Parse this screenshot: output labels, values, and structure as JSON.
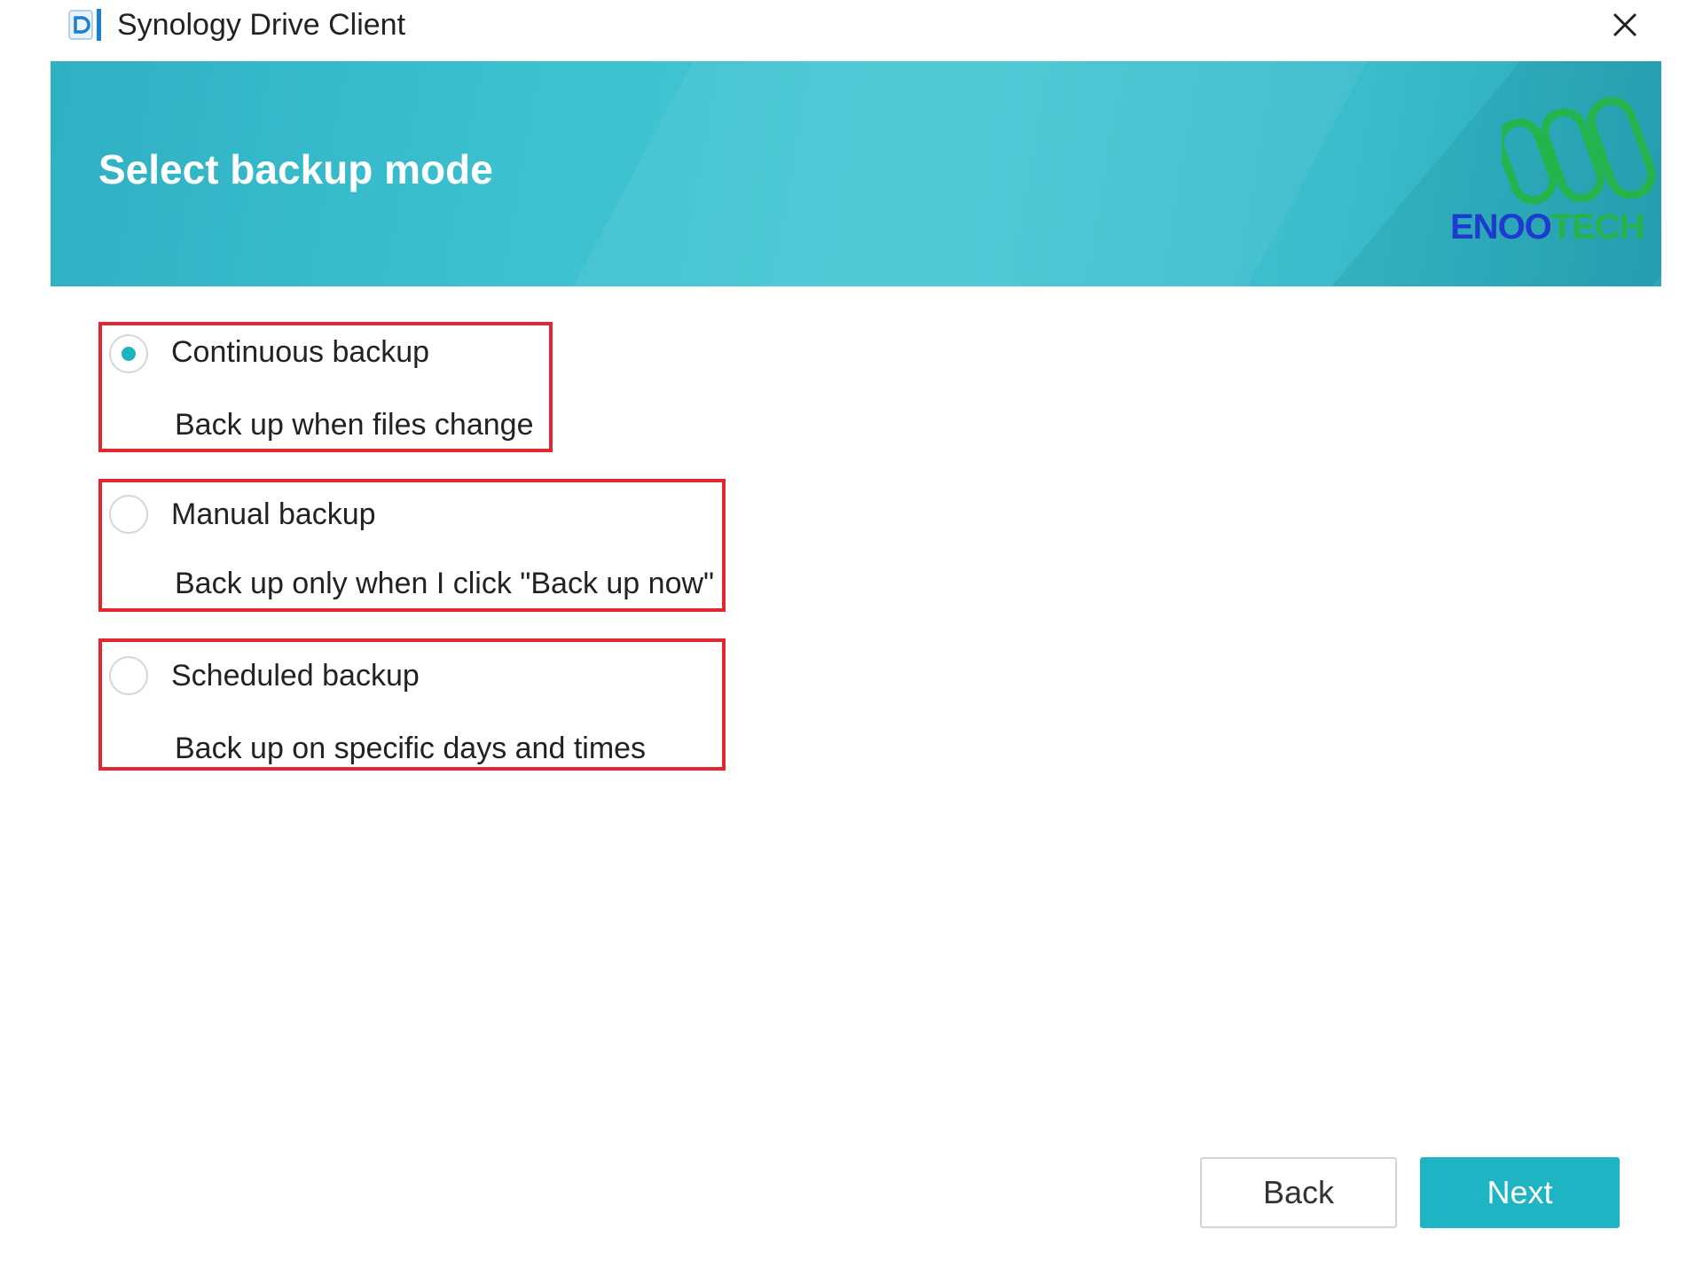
{
  "window": {
    "title": "Synology Drive Client",
    "icon": "synology-drive-icon",
    "close_icon": "close-icon"
  },
  "banner": {
    "title": "Select backup mode",
    "logo_text_part1": "ENOO",
    "logo_text_part2": "TECH",
    "colors": {
      "banner": "#3cc1cf",
      "logo_blue": "#1d3ccf",
      "logo_green": "#25b34b"
    }
  },
  "options": [
    {
      "label": "Continuous backup",
      "description": "Back up when files change",
      "selected": true
    },
    {
      "label": "Manual backup",
      "description": "Back up only when I click \"Back up now\"",
      "selected": false
    },
    {
      "label": "Scheduled backup",
      "description": "Back up on specific days and times",
      "selected": false
    }
  ],
  "buttons": {
    "back": "Back",
    "next": "Next"
  },
  "colors": {
    "accent": "#1fb4c3",
    "highlight_border": "#e0262e"
  }
}
